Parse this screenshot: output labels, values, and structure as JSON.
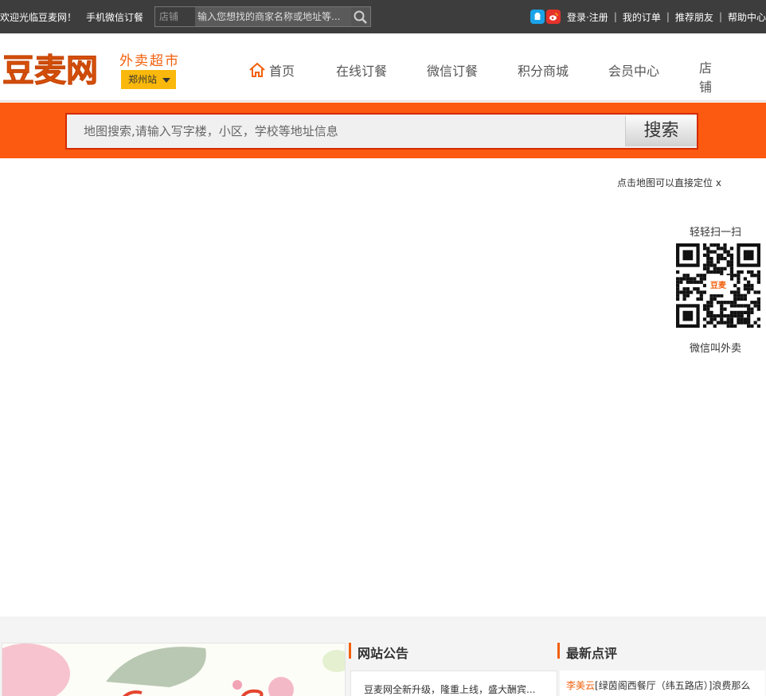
{
  "topbar": {
    "welcome": "欢迎光临豆麦网！",
    "wechat_order": "手机微信订餐",
    "search_category": "店铺",
    "search_placeholder": "输入您想找的商家名称或地址等...",
    "login": "登录·注册",
    "my_orders": "我的订单",
    "recommend": "推荐朋友",
    "help": "帮助中心"
  },
  "header": {
    "logo_text": "豆麦网",
    "logo_sub": "外卖超市",
    "city": "郑州站",
    "nav": [
      {
        "label": "首页"
      },
      {
        "label": "在线订餐"
      },
      {
        "label": "微信订餐"
      },
      {
        "label": "积分商城"
      },
      {
        "label": "会员中心"
      },
      {
        "label": "店铺"
      }
    ]
  },
  "search": {
    "placeholder": "地图搜索,请输入写字楼，小区，学校等地址信息",
    "button": "搜索"
  },
  "map": {
    "hint": "点击地图可以直接定位",
    "hint_close": "x",
    "scan_label": "轻轻扫一扫",
    "qr_logo": "豆麦",
    "qr_caption": "微信叫外卖"
  },
  "notice": {
    "title": "网站公告",
    "items": [
      "豆麦网全新升级，隆重上线，盛大酬宾..."
    ]
  },
  "reviews": {
    "title": "最新点评",
    "items": [
      {
        "user": "李美云",
        "text": "[绿茵阁西餐厅（纬五路店）]浪费那么"
      }
    ]
  },
  "colors": {
    "brand": "#f2600c",
    "band": "#fb5a10",
    "city_btn": "#f9b80b",
    "topbar": "#3d3d3d"
  }
}
